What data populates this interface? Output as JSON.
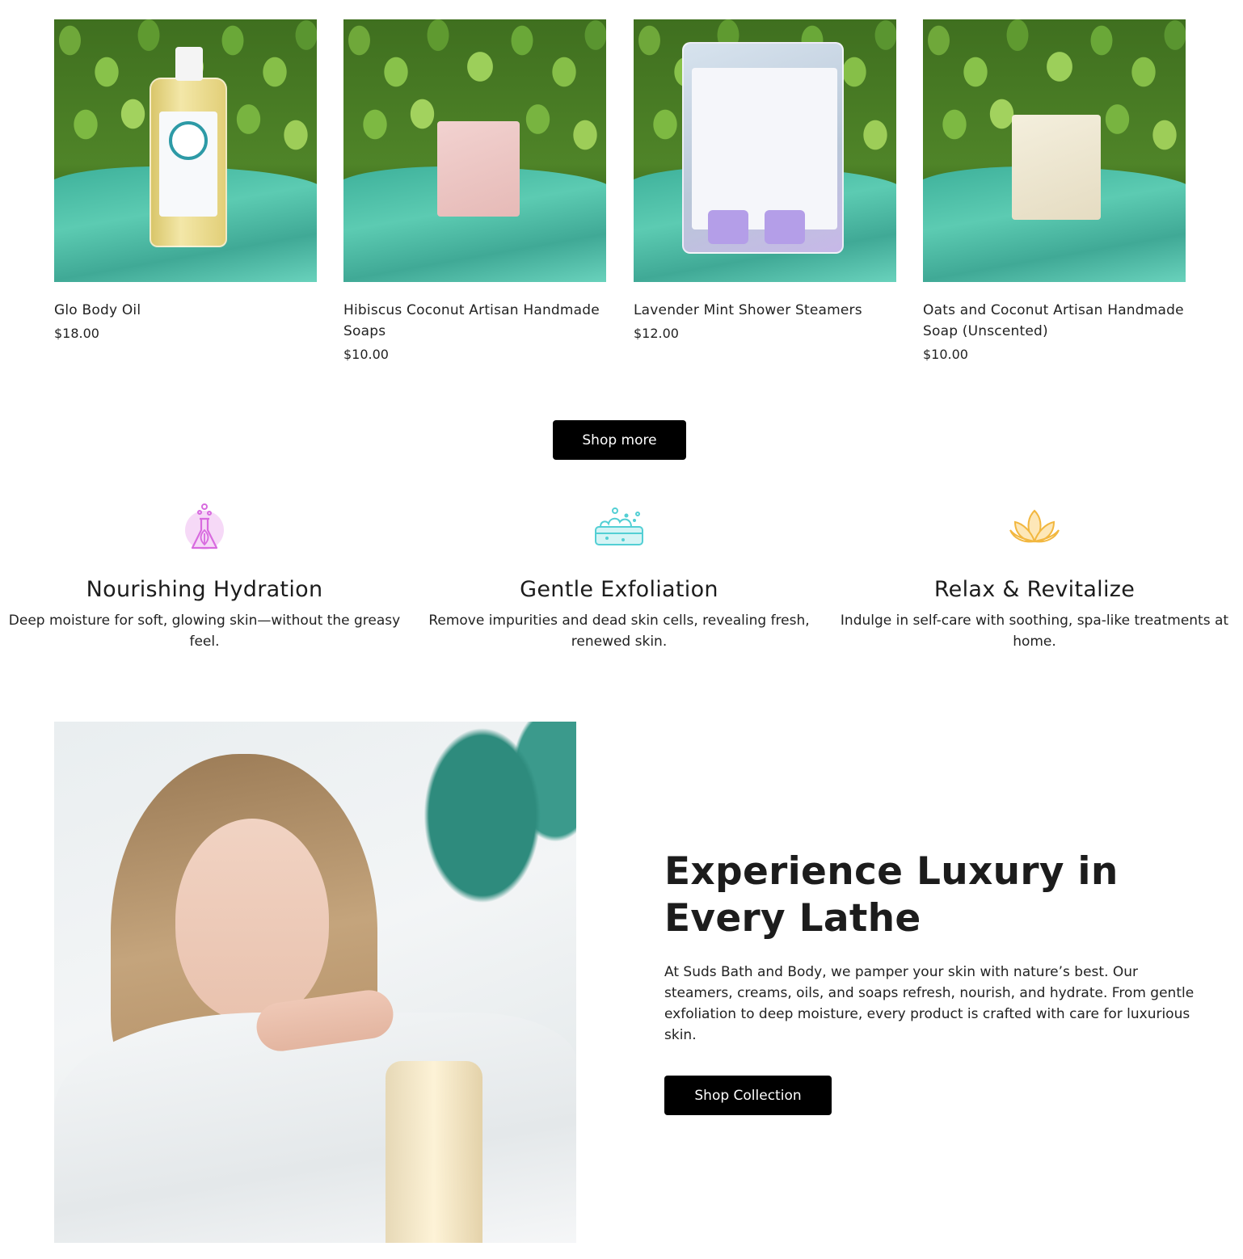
{
  "products": [
    {
      "name": "Glo Body Oil",
      "price": "$18.00",
      "image": "body-oil-bottle"
    },
    {
      "name": "Hibiscus Coconut Artisan Handmade Soaps",
      "price": "$10.00",
      "image": "pink-soap-bar"
    },
    {
      "name": "Lavender Mint Shower Steamers",
      "price": "$12.00",
      "image": "shower-steamer-bag"
    },
    {
      "name": "Oats and Coconut Artisan Handmade Soap (Unscented)",
      "price": "$10.00",
      "image": "cream-soap-bar"
    }
  ],
  "shop_more_label": "Shop more",
  "features": [
    {
      "title": "Nourishing Hydration",
      "text": "Deep moisture for soft, glowing skin—without the greasy feel.",
      "icon": "flask-icon",
      "color": "#d86bdf"
    },
    {
      "title": "Gentle Exfoliation",
      "text": "Remove impurities and dead skin cells, revealing fresh, renewed skin.",
      "icon": "soap-foam-icon",
      "color": "#53cfd4"
    },
    {
      "title": "Relax & Revitalize",
      "text": "Indulge in self-care with soothing, spa-like treatments at home.",
      "icon": "lotus-icon",
      "color": "#f2b73f"
    }
  ],
  "hero": {
    "title": "Experience Luxury in Every Lathe",
    "text": "At Suds Bath and Body, we pamper your skin with nature’s best. Our steamers, creams, oils, and soaps refresh, nourish, and hydrate. From gentle exfoliation to deep moisture, every product is crafted with care for luxurious skin.",
    "button_label": "Shop Collection"
  }
}
